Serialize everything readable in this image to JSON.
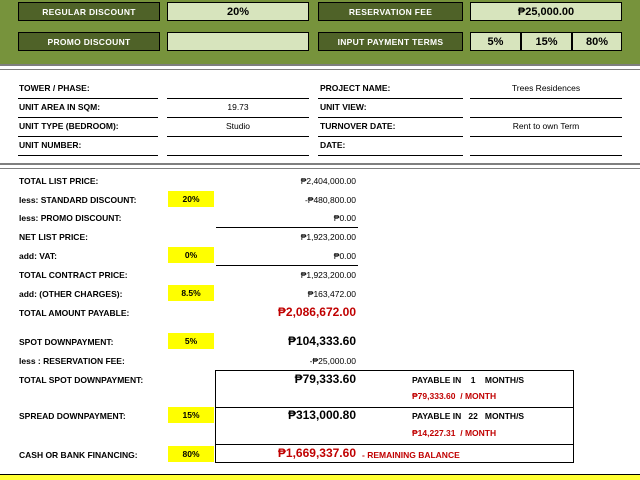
{
  "header": {
    "regular_discount_label": "REGULAR DISCOUNT",
    "regular_discount_value": "20%",
    "reservation_fee_label": "RESERVATION FEE",
    "reservation_fee_value": "₱25,000.00",
    "promo_discount_label": "PROMO DISCOUNT",
    "promo_discount_value": "",
    "payment_terms_label": "INPUT PAYMENT TERMS",
    "term_1": "5%",
    "term_2": "15%",
    "term_3": "80%"
  },
  "info": {
    "tower_label": "TOWER / PHASE:",
    "tower_value": "",
    "area_label": "UNIT AREA IN SQM:",
    "area_value": "19.73",
    "type_label": "UNIT TYPE (BEDROOM):",
    "type_value": "Studio",
    "number_label": "UNIT NUMBER:",
    "number_value": "",
    "project_label": "PROJECT NAME:",
    "project_value": "Trees Residences",
    "view_label": "UNIT VIEW:",
    "view_value": "",
    "turnover_label": "TURNOVER DATE:",
    "turnover_value": "Rent to own Term",
    "date_label": "DATE:",
    "date_value": ""
  },
  "computation": {
    "total_list_price_label": "TOTAL LIST PRICE:",
    "total_list_price": "₱2,404,000.00",
    "std_discount_label": "less: STANDARD DISCOUNT:",
    "std_discount_pct": "20%",
    "std_discount": "-₱480,800.00",
    "promo_discount_label": "less: PROMO DISCOUNT:",
    "promo_discount": "₱0.00",
    "net_list_price_label": "NET LIST PRICE:",
    "net_list_price": "₱1,923,200.00",
    "vat_label": "add: VAT:",
    "vat_pct": "0%",
    "vat": "₱0.00",
    "tcp_label": "TOTAL CONTRACT PRICE:",
    "tcp": "₱1,923,200.00",
    "other_label": "add: (OTHER CHARGES):",
    "other_pct": "8.5%",
    "other": "₱163,472.00",
    "total_payable_label": "TOTAL AMOUNT PAYABLE:",
    "total_payable": "₱2,086,672.00",
    "spot_dp_label": "SPOT DOWNPAYMENT:",
    "spot_dp_pct": "5%",
    "spot_dp": "₱104,333.60",
    "res_fee_label": "less : RESERVATION FEE:",
    "res_fee": "-₱25,000.00",
    "total_spot_label": "TOTAL SPOT DOWNPAYMENT:",
    "total_spot": "₱79,333.60",
    "total_spot_payable": "PAYABLE IN    1    MONTH/S",
    "total_spot_monthly": "₱79,333.60",
    "per_month": "/ MONTH",
    "spread_label": "SPREAD DOWNPAYMENT:",
    "spread_pct": "15%",
    "spread": "₱313,000.80",
    "spread_payable": "PAYABLE IN   22   MONTH/S",
    "spread_monthly": "₱14,227.31",
    "per_month_2": "/ MONTH",
    "financing_label": "CASH OR BANK FINANCING:",
    "financing_pct": "80%",
    "financing": "₱1,669,337.60",
    "remaining": "- REMAINING BALANCE"
  },
  "colors": {
    "header_bg": "#77933c",
    "dark_box": "#4f6228",
    "light_box": "#d7e4bd",
    "highlight": "#ffff00",
    "red_text": "#c00000"
  }
}
